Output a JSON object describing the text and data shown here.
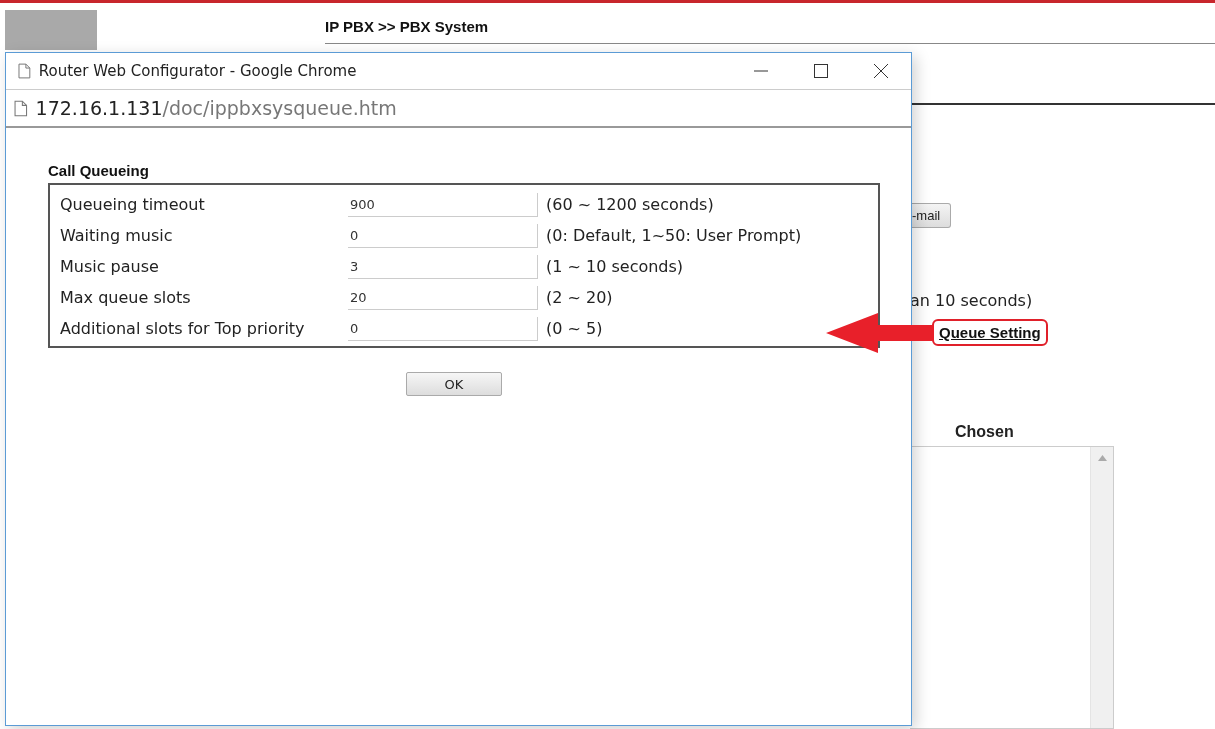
{
  "page": {
    "breadcrumb": "IP PBX >> PBX System",
    "email_button": "-mail",
    "hint": "an 10 seconds)",
    "queue_link": "Queue Setting",
    "chosen_label": "Chosen"
  },
  "popup": {
    "title": "Router Web Configurator - Google Chrome",
    "url_host": "172.16.1.131",
    "url_path": "/doc/ippbxsysqueue.htm",
    "section_title": "Call Queueing",
    "rows": [
      {
        "label": "Queueing timeout",
        "value": "900",
        "range": "(60 ~ 1200 seconds)"
      },
      {
        "label": "Waiting music",
        "value": "0",
        "range": "(0: Default, 1~50: User Prompt)"
      },
      {
        "label": "Music pause",
        "value": "3",
        "range": "(1 ~ 10 seconds)"
      },
      {
        "label": "Max queue slots",
        "value": "20",
        "range": "(2 ~ 20)"
      },
      {
        "label": "Additional slots for Top priority",
        "value": "0",
        "range": "(0 ~ 5)"
      }
    ],
    "ok_button": "OK"
  }
}
